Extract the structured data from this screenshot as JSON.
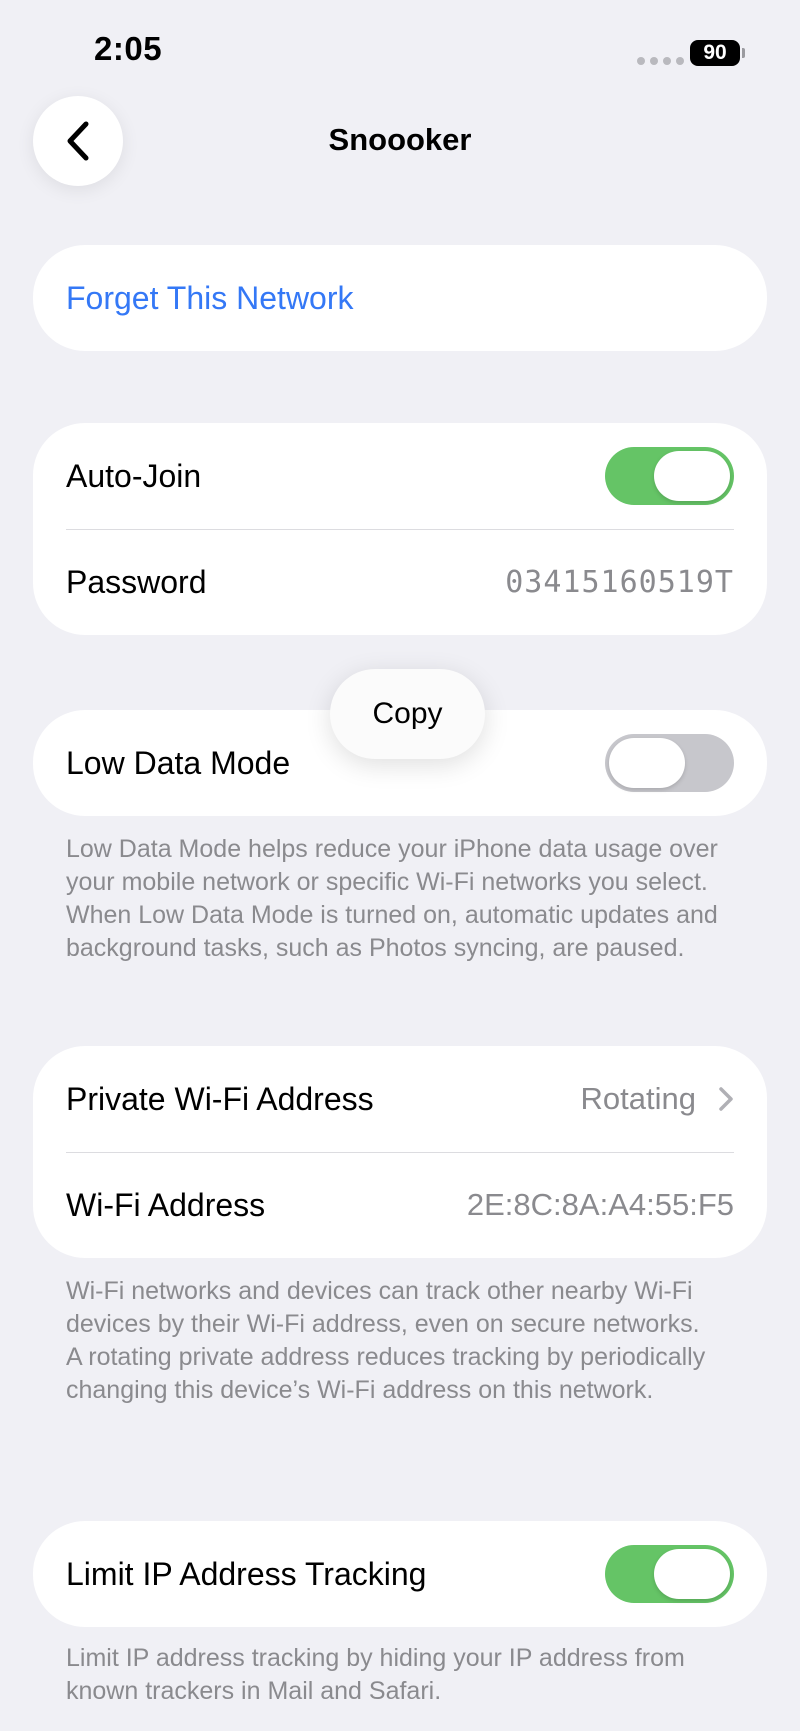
{
  "status_bar": {
    "time": "2:05",
    "battery": "90"
  },
  "nav": {
    "back_icon": "chevron-left-icon",
    "title": "Snoooker"
  },
  "forget": {
    "label": "Forget This Network"
  },
  "join_group": {
    "auto_join": {
      "label": "Auto-Join",
      "enabled": true
    },
    "password": {
      "label": "Password",
      "value": "03415160519T"
    }
  },
  "copy_popover": {
    "label": "Copy"
  },
  "low_data": {
    "label": "Low Data Mode",
    "enabled": false,
    "footer": "Low Data Mode helps reduce your iPhone data usage over your mobile network or specific Wi-Fi networks you select. When Low Data Mode is turned on, automatic updates and background tasks, such as Photos syncing, are paused."
  },
  "address_group": {
    "private_address": {
      "label": "Private Wi-Fi Address",
      "value": "Rotating"
    },
    "wifi_address": {
      "label": "Wi-Fi Address",
      "value": "2E:8C:8A:A4:55:F5"
    },
    "footer_line1": "Wi-Fi networks and devices can track other nearby Wi-Fi devices by their Wi-Fi address, even on secure networks.",
    "footer_line2": "A rotating private address reduces tracking by periodically changing this device’s Wi-Fi address on this network."
  },
  "limit_ip": {
    "label": "Limit IP Address Tracking",
    "enabled": true,
    "footer": "Limit IP address tracking by hiding your IP address from known trackers in Mail and Safari."
  },
  "colors": {
    "background": "#f0f0f5",
    "accent": "#3478f6",
    "toggle_on": "#65c466",
    "toggle_off": "#c7c7cc",
    "secondary_text": "#8a8a8e"
  }
}
